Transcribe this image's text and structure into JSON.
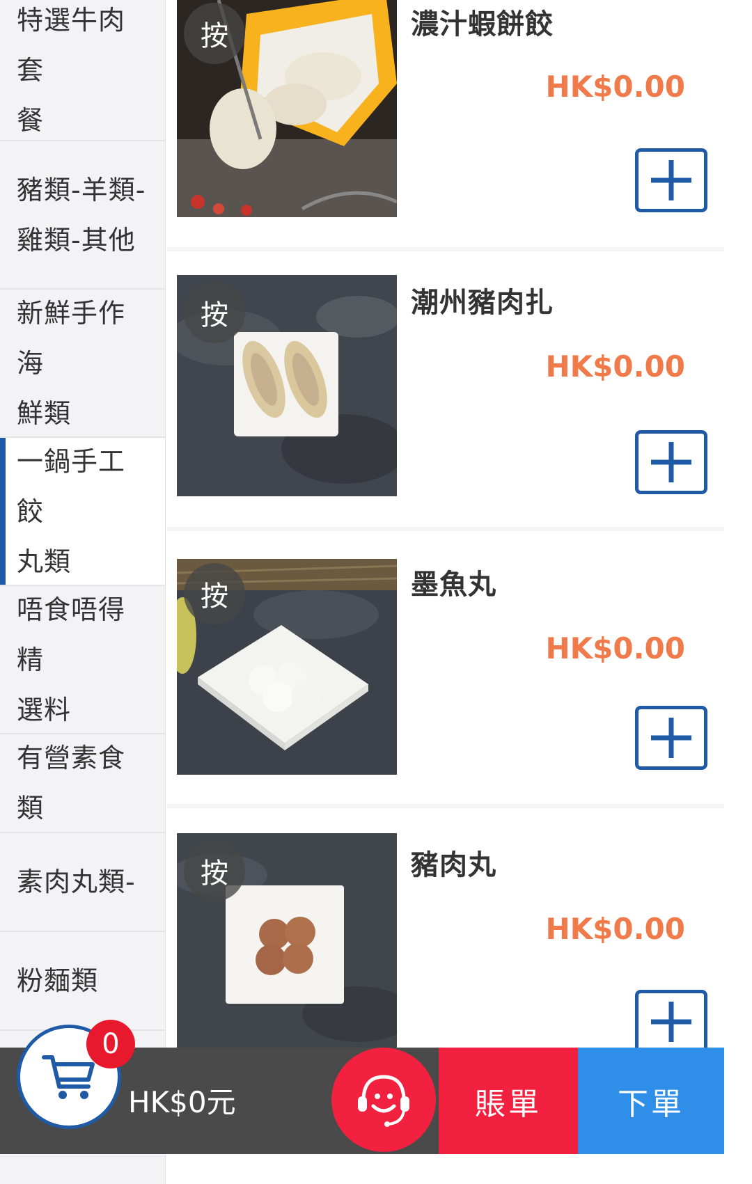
{
  "sidebar": {
    "items": [
      {
        "line1": "特選牛肉套",
        "line2": "餐"
      },
      {
        "line1": "豬類-羊類-",
        "line2": "雞類-其他"
      },
      {
        "line1": "新鮮手作海",
        "line2": "鮮類"
      },
      {
        "line1": "一鍋手工餃",
        "line2": "丸類"
      },
      {
        "line1": "唔食唔得精",
        "line2": "選料"
      },
      {
        "line1": "有營素食類",
        "line2": ""
      },
      {
        "line1": "素肉丸類-",
        "line2": ""
      },
      {
        "line1": "粉麵類",
        "line2": ""
      }
    ],
    "active_index": 3
  },
  "products": [
    {
      "name": "濃汁蝦餅餃",
      "price": "HK$0.00",
      "badge": "按",
      "image": "dumpling-photo"
    },
    {
      "name": "潮州豬肉扎",
      "price": "HK$0.00",
      "badge": "按",
      "image": "pork-roll-photo"
    },
    {
      "name": "墨魚丸",
      "price": "HK$0.00",
      "badge": "按",
      "image": "cuttlefish-ball-photo"
    },
    {
      "name": "豬肉丸",
      "price": "HK$0.00",
      "badge": "按",
      "image": "pork-ball-photo"
    }
  ],
  "bottom_bar": {
    "cart_count": "0",
    "cart_total": "HK$0元",
    "bill_label": "賬單",
    "order_label": "下單"
  },
  "colors": {
    "accent_blue": "#1f5aa6",
    "price_orange": "#f07a4a",
    "bill_red": "#f2203f",
    "order_blue": "#2f8fe8"
  }
}
